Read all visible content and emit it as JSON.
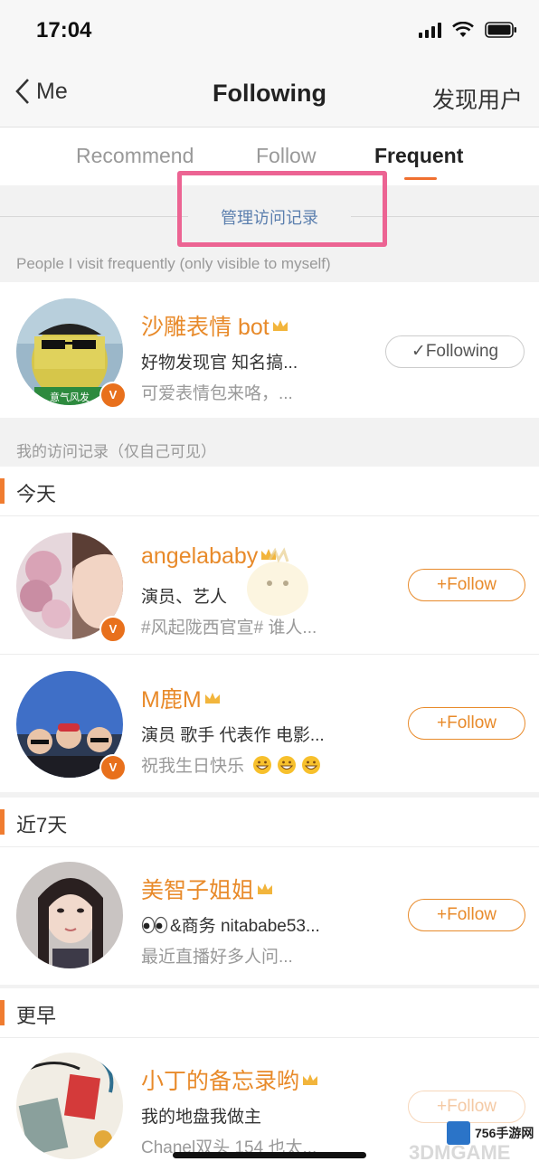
{
  "status_bar": {
    "time": "17:04"
  },
  "nav": {
    "back_label": "Me",
    "title": "Following",
    "right_action": "发现用户"
  },
  "tabs": [
    {
      "label": "Recommend",
      "active": false
    },
    {
      "label": "Follow",
      "active": false
    },
    {
      "label": "Frequent",
      "active": true
    }
  ],
  "manage_link": "管理访问记录",
  "frequent_section": {
    "caption": "People I visit frequently (only visible to myself)",
    "user": {
      "name": "沙雕表情 bot",
      "line1": "好物发现官 知名搞...",
      "line2": "可爱表情包来咯，...",
      "button": "✓Following",
      "verified_badge": "V"
    }
  },
  "history_section": {
    "caption": "我的访问记录（仅自己可见）",
    "groups": [
      {
        "title": "今天",
        "users": [
          {
            "name": "angelababy",
            "line1": "演员、艺人",
            "line2": "#风起陇西官宣# 谁人...",
            "button": "+Follow",
            "verified_badge": "V"
          },
          {
            "name": "M鹿M",
            "line1": "演员 歌手 代表作 电影...",
            "line2": "祝我生日快乐",
            "button": "+Follow",
            "verified_badge": "V"
          }
        ]
      },
      {
        "title": "近7天",
        "users": [
          {
            "name": "美智子姐姐",
            "line1": "&商务 nitababe53...",
            "line2": "最近直播好多人问...",
            "button": "+Follow"
          }
        ]
      },
      {
        "title": "更早",
        "users": [
          {
            "name": "小丁的备忘录哟",
            "line1": "我的地盘我做主",
            "line2": "Chanel双头 154 也太...",
            "button": "+Follow"
          }
        ]
      }
    ]
  },
  "watermarks": {
    "badge": "756手游网",
    "faint": "3DMGAME"
  },
  "colors": {
    "accent": "#e88a2a",
    "tab_underline": "#f07030",
    "link": "#5b7fae",
    "highlight_box": "#ec6493"
  }
}
